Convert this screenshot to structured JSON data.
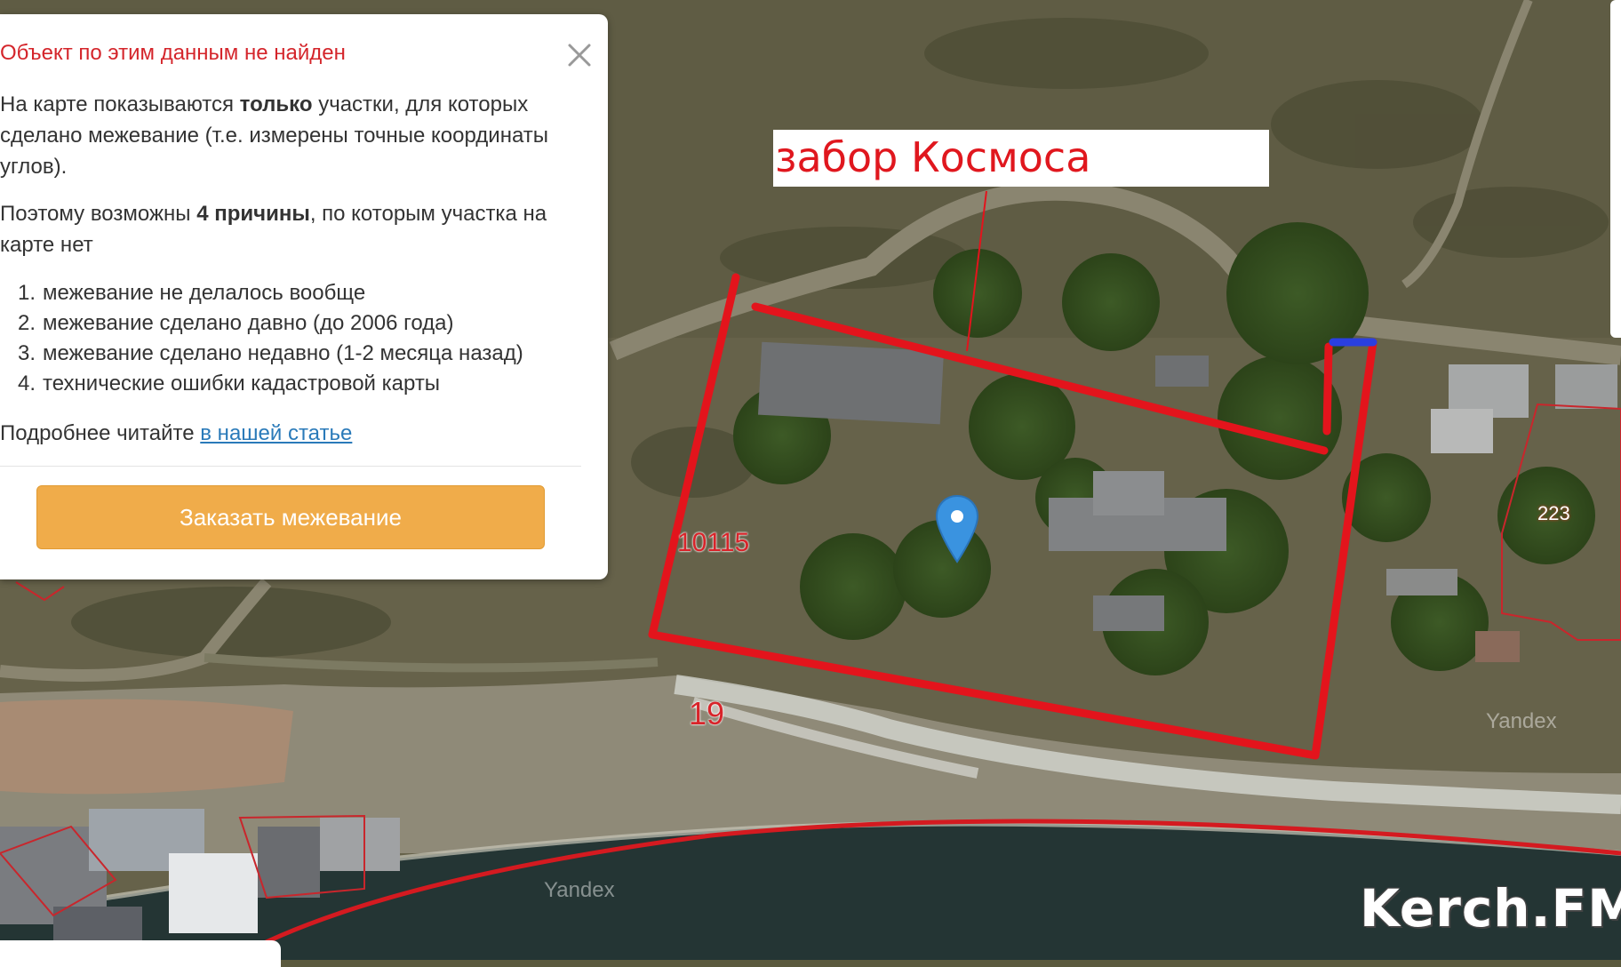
{
  "popup": {
    "title": "Объект по этим данным не найден",
    "p1_a": "На карте показываются ",
    "p1_b": "только",
    "p1_c": " участки, для которых сделано межевание (т.е. измерены точные координаты углов).",
    "p2_a": "Поэтому возможны ",
    "p2_b": "4 причины",
    "p2_c": ", по которым участка на карте нет",
    "reasons": [
      {
        "n": "1.",
        "text": "межевание не делалось вообще"
      },
      {
        "n": "2.",
        "text": "межевание сделано давно (до 2006 года)"
      },
      {
        "n": "3.",
        "text": "межевание сделано недавно (1-2 месяца назад)"
      },
      {
        "n": "4.",
        "text": "технические ошибки кадастровой карты"
      }
    ],
    "more_text": "Подробнее читайте ",
    "more_link": "в нашей статье",
    "button_label": "Заказать межевание",
    "close_icon": "close-icon"
  },
  "annotation": {
    "label": "забор Космоса"
  },
  "map": {
    "parcel_labels": [
      "10115",
      "19",
      "223"
    ],
    "watermarks": [
      "Yandex",
      "Yandex"
    ],
    "marker_icon": "location-pin-icon",
    "marker_color": "#3a93e0",
    "boundary_color": "#e3141c"
  },
  "site_watermark": "Kerch.FM"
}
